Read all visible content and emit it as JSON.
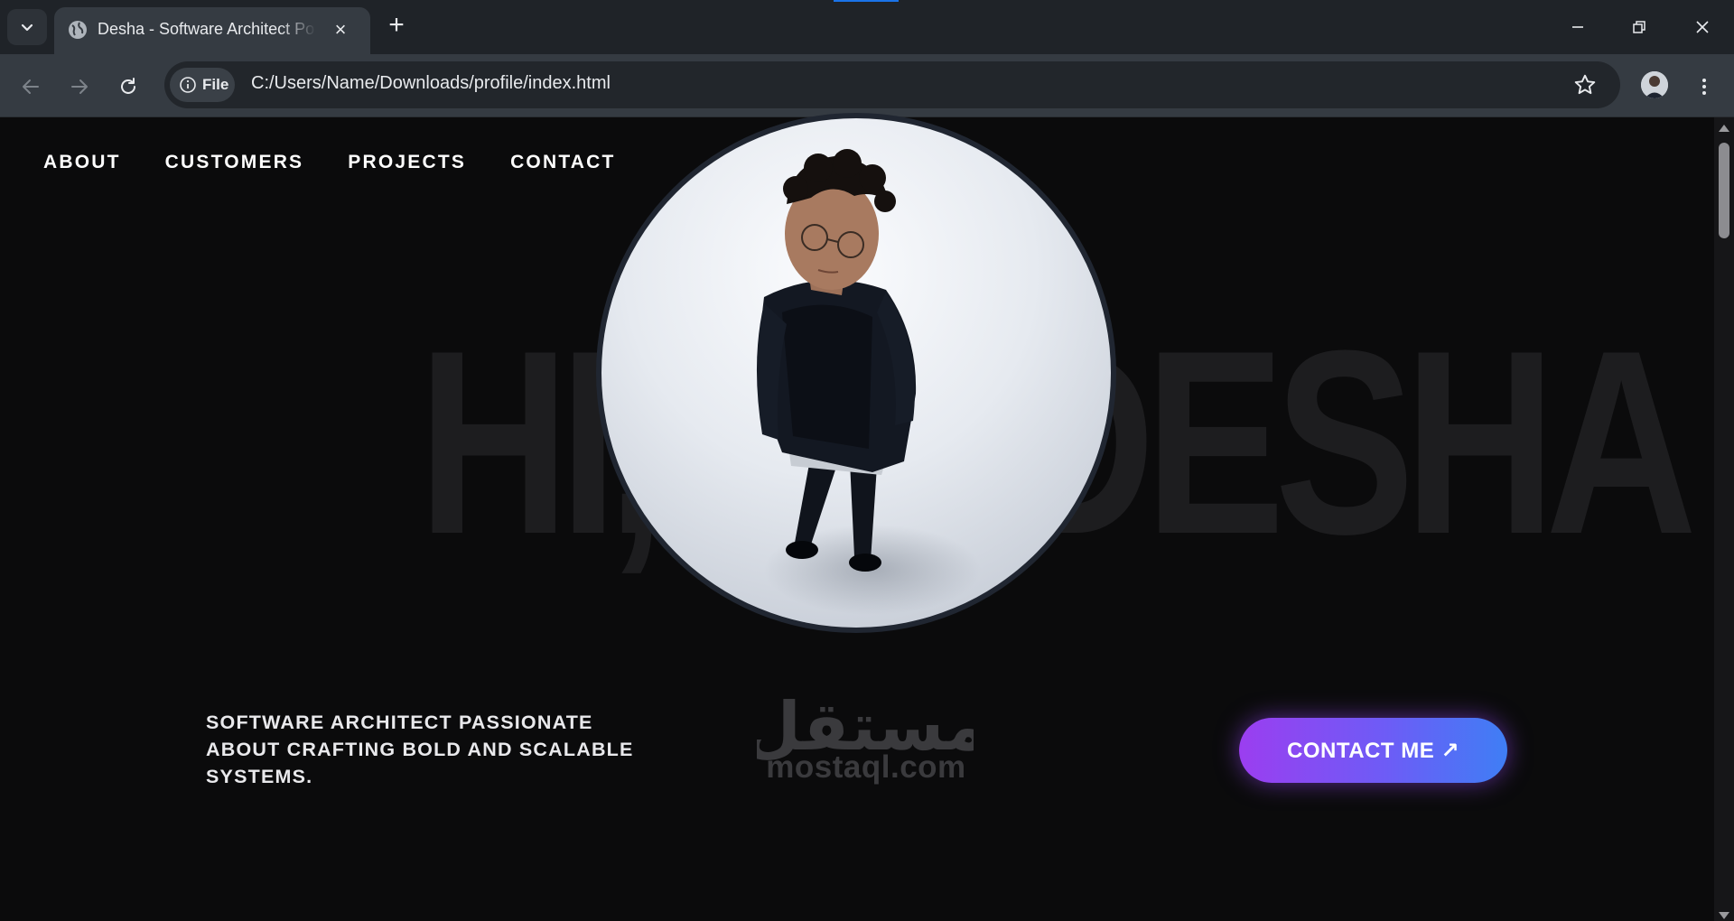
{
  "browser": {
    "tab_title": "Desha - Software Architect Portfolio",
    "tab_close": "×",
    "new_tab": "+",
    "file_chip": "File",
    "url": "C:/Users/Name/Downloads/profile/index.html"
  },
  "site": {
    "nav": [
      "ABOUT",
      "CUSTOMERS",
      "PROJECTS",
      "CONTACT"
    ],
    "hero_background_text": "HI, I'M DESHA",
    "tagline": "SOFTWARE ARCHITECT PASSIONATE ABOUT CRAFTING BOLD AND SCALABLE SYSTEMS.",
    "cta_label": "CONTACT ME ↗",
    "watermark_arabic": "مستقل",
    "watermark_latin": "mostaql.com"
  },
  "colors": {
    "page_bg": "#0b0b0c",
    "cta_gradient_start": "#9b3ef0",
    "cta_gradient_end": "#3f7ef5"
  }
}
